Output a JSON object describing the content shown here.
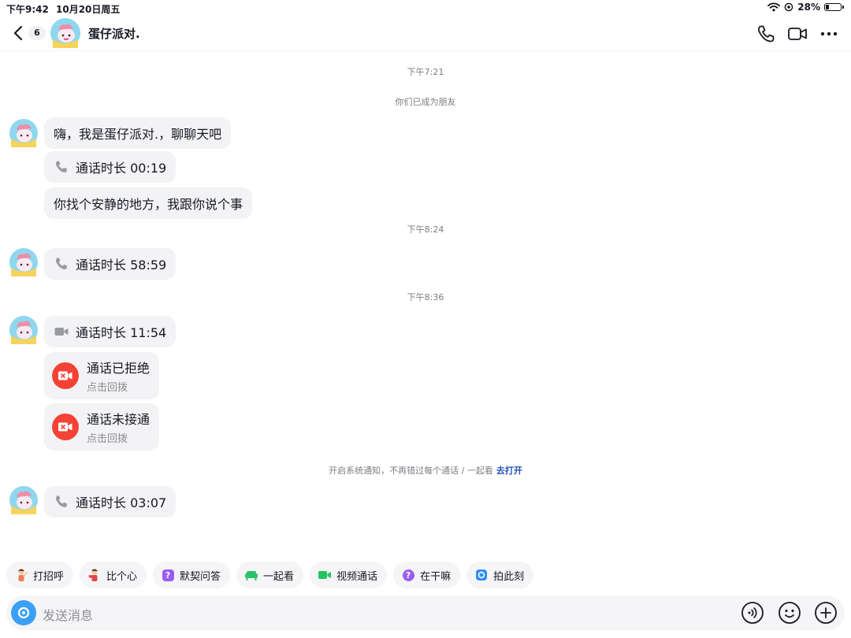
{
  "status_bar": {
    "time": "下午9:42",
    "date": "10月20日周五",
    "battery": "28%",
    "battery_level": 0.28
  },
  "header": {
    "unread_count": "6",
    "contact_name": "蛋仔派对."
  },
  "chat": {
    "system": {
      "time1": "下午7:21",
      "friend_notice": "你们已成为朋友",
      "time2": "下午8:24",
      "time3": "下午8:36",
      "notify_text": "开启系统通知，不再错过每个通话 / 一起看",
      "notify_link": "去打开"
    },
    "messages": {
      "greeting": "嗨，我是蛋仔派对.，聊聊天吧",
      "call1": "通话时长 00:19",
      "find_quiet": "你找个安静的地方，我跟你说个事",
      "call2": "通话时长 58:59",
      "video_call": "通话时长 11:54",
      "rejected_title": "通话已拒绝",
      "rejected_sub": "点击回拨",
      "missed_title": "通话未接通",
      "missed_sub": "点击回拨",
      "call3": "通话时长 03:07"
    }
  },
  "quick_actions": [
    "打招呼",
    "比个心",
    "默契问答",
    "一起看",
    "视频通话",
    "在干嘛",
    "拍此刻"
  ],
  "input": {
    "placeholder": "发送消息"
  },
  "colors": {
    "accent": "#3aa0f5",
    "danger": "#f44336",
    "link": "#1f4fb8",
    "bubble": "#f3f3f5"
  }
}
